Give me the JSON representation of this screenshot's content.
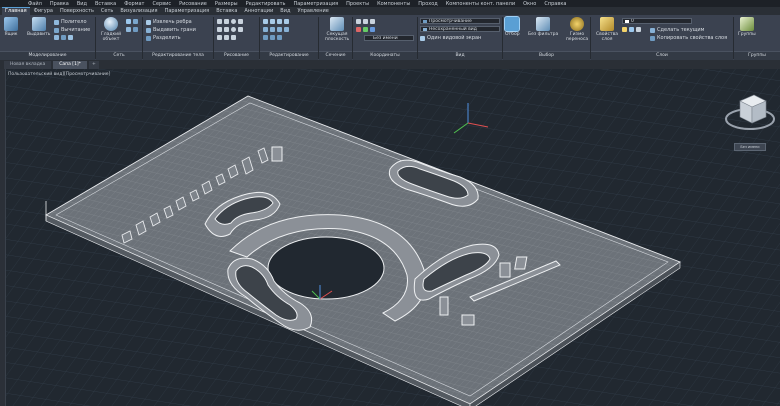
{
  "menubar": {
    "items": [
      "Файл",
      "Правка",
      "Вид",
      "Вставка",
      "Формат",
      "Сервис",
      "Рисование",
      "Размеры",
      "Редактировать",
      "Параметризация",
      "Проекты",
      "Компоненты",
      "Проход",
      "Компоненты конт. панели",
      "Окно",
      "Справка"
    ]
  },
  "tabs": {
    "items": [
      "Главная",
      "Фигура",
      "Поверхность",
      "Сеть",
      "Визуализация",
      "Параметризация",
      "Вставка",
      "Аннотации",
      "Вид",
      "Управление"
    ]
  },
  "ribbon": {
    "ashchik": "Ящик",
    "vydavit": "Выдавить",
    "politelo": "Политело",
    "vychitanie": "Вычитание",
    "gladkiy": "Гладкий объект",
    "izvlech": "Извлечь ребра",
    "vydavit_grani": "Выдавить грани",
    "razdelit": "Разделить",
    "sekushaya": "Секущая плоскость",
    "bez_imeni": "Без имени",
    "prosmotr": "Просмотрчивание",
    "nesohr": "Несохраненный вид",
    "odin": "Один видовой экран",
    "otbor": "Отбор",
    "bez_filtra": "Без фильтра",
    "gizmo": "Гизмо переноса",
    "svoystva_sloya": "Свойства слоя",
    "layer_value": "0",
    "sdelat_tek": "Сделать текущим",
    "kopirovat": "Копировать свойства слоя",
    "gruppy": "Группы"
  },
  "panels": {
    "modelirovanie": "Моделирование",
    "set": "Сеть",
    "redakt_tela": "Редактирование тела",
    "risovanie": "Рисование",
    "redaktirovanie": "Редактирование",
    "sechenie": "Сечение",
    "koordinaty": "Координаты",
    "vid": "Вид",
    "vybor": "Выбор",
    "sloi": "Слои",
    "gruppy": "Группы"
  },
  "file_tabs": {
    "items": [
      "Новая вкладка",
      "Сапа [1]*",
      "+"
    ]
  },
  "viewport": {
    "label": "Пользовательский вид][Просмотрчивание]",
    "wcs_label": "Без имени"
  },
  "colors": {
    "accent": "#5a9fd4",
    "viewport_bg": "#212830",
    "grid_line": "#3a4350",
    "model": "#e8eaed"
  }
}
